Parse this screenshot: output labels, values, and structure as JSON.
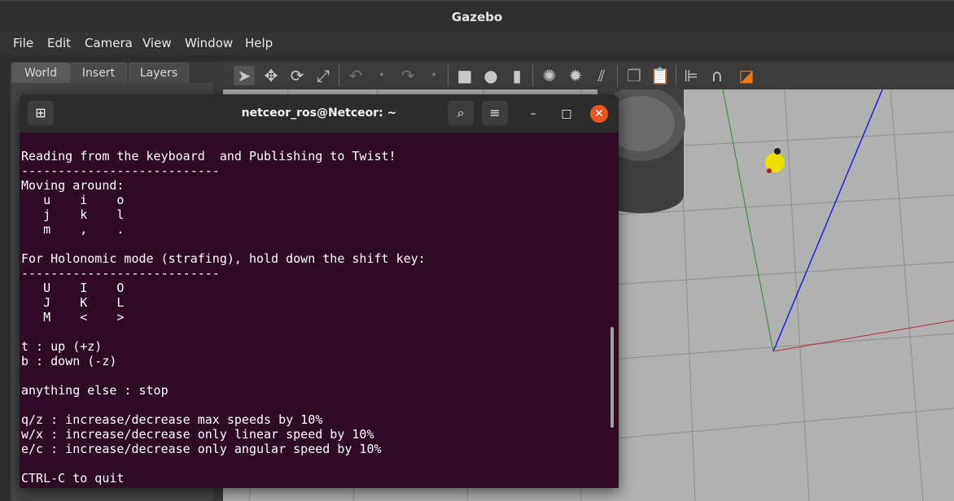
{
  "window": {
    "title": "Gazebo"
  },
  "menu": [
    "File",
    "Edit",
    "Camera",
    "View",
    "Window",
    "Help"
  ],
  "left_panel": {
    "tabs": [
      "World",
      "Insert",
      "Layers"
    ]
  },
  "toolbar": {
    "icons": [
      "select-arrow-icon",
      "translate-icon",
      "rotate-icon",
      "scale-icon",
      "undo-icon",
      "undo-dropdown-icon",
      "redo-icon",
      "redo-dropdown-icon",
      "box-icon",
      "sphere-icon",
      "cylinder-icon",
      "point-light-icon",
      "spot-light-icon",
      "directional-light-icon",
      "copy-icon",
      "paste-icon",
      "align-icon",
      "snap-icon",
      "view-angle-icon"
    ]
  },
  "terminal": {
    "title": "netceor_ros@Netceor: ~",
    "lines": [
      "Reading from the keyboard  and Publishing to Twist!",
      "---------------------------",
      "Moving around:",
      "   u    i    o",
      "   j    k    l",
      "   m    ,    .",
      "",
      "For Holonomic mode (strafing), hold down the shift key:",
      "---------------------------",
      "   U    I    O",
      "   J    K    L",
      "   M    <    >",
      "",
      "t : up (+z)",
      "b : down (-z)",
      "",
      "anything else : stop",
      "",
      "q/z : increase/decrease max speeds by 10%",
      "w/x : increase/decrease only linear speed by 10%",
      "e/c : increase/decrease only angular speed by 10%",
      "",
      "CTRL-C to quit"
    ]
  }
}
